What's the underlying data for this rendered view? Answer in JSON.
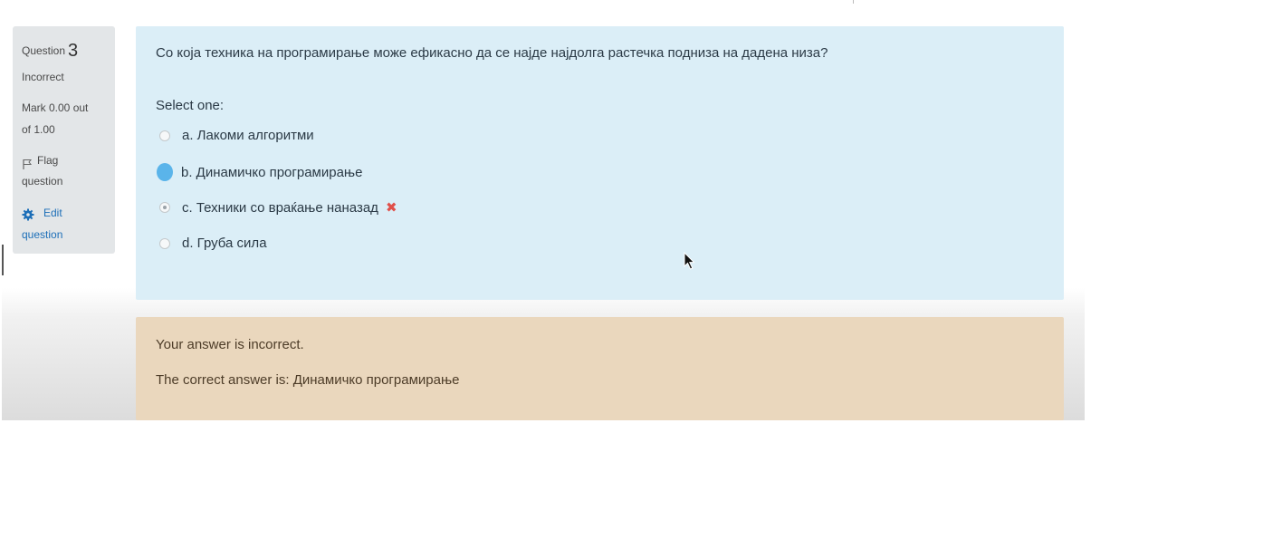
{
  "question_info": {
    "label": "Question",
    "number": "3",
    "state": "Incorrect",
    "mark_line1": "Mark 0.00 out",
    "mark_line2": "of 1.00",
    "flag_line1": "Flag",
    "flag_line2": "question",
    "edit_line1": "Edit",
    "edit_line2": "question"
  },
  "question": {
    "text": "Со која техника на програмирање може ефикасно да се најде најдолга растечка подниза на дадена низа?",
    "prompt": "Select one:",
    "options": [
      {
        "label": "a. Лакоми алгоритми",
        "state": "unselected"
      },
      {
        "label": "b. Динамичко програмирање",
        "state": "highlighted"
      },
      {
        "label": "c. Техники со враќање наназад",
        "state": "selected-incorrect"
      },
      {
        "label": "d. Груба сила",
        "state": "unselected"
      }
    ]
  },
  "feedback": {
    "message": "Your answer is incorrect.",
    "right_answer": "The correct answer is: Динамичко програмирање"
  },
  "colors": {
    "question_bg": "#dbeef7",
    "outcome_bg": "#ead7bd",
    "info_bg": "#e3e6e8",
    "link": "#1d6fb8",
    "incorrect": "#e0504a",
    "highlight": "#5ab4ea"
  },
  "icons": {
    "flag": "flag-icon",
    "edit": "gear-icon",
    "incorrect": "cross-icon",
    "pointer": "mouse-cursor-icon"
  }
}
